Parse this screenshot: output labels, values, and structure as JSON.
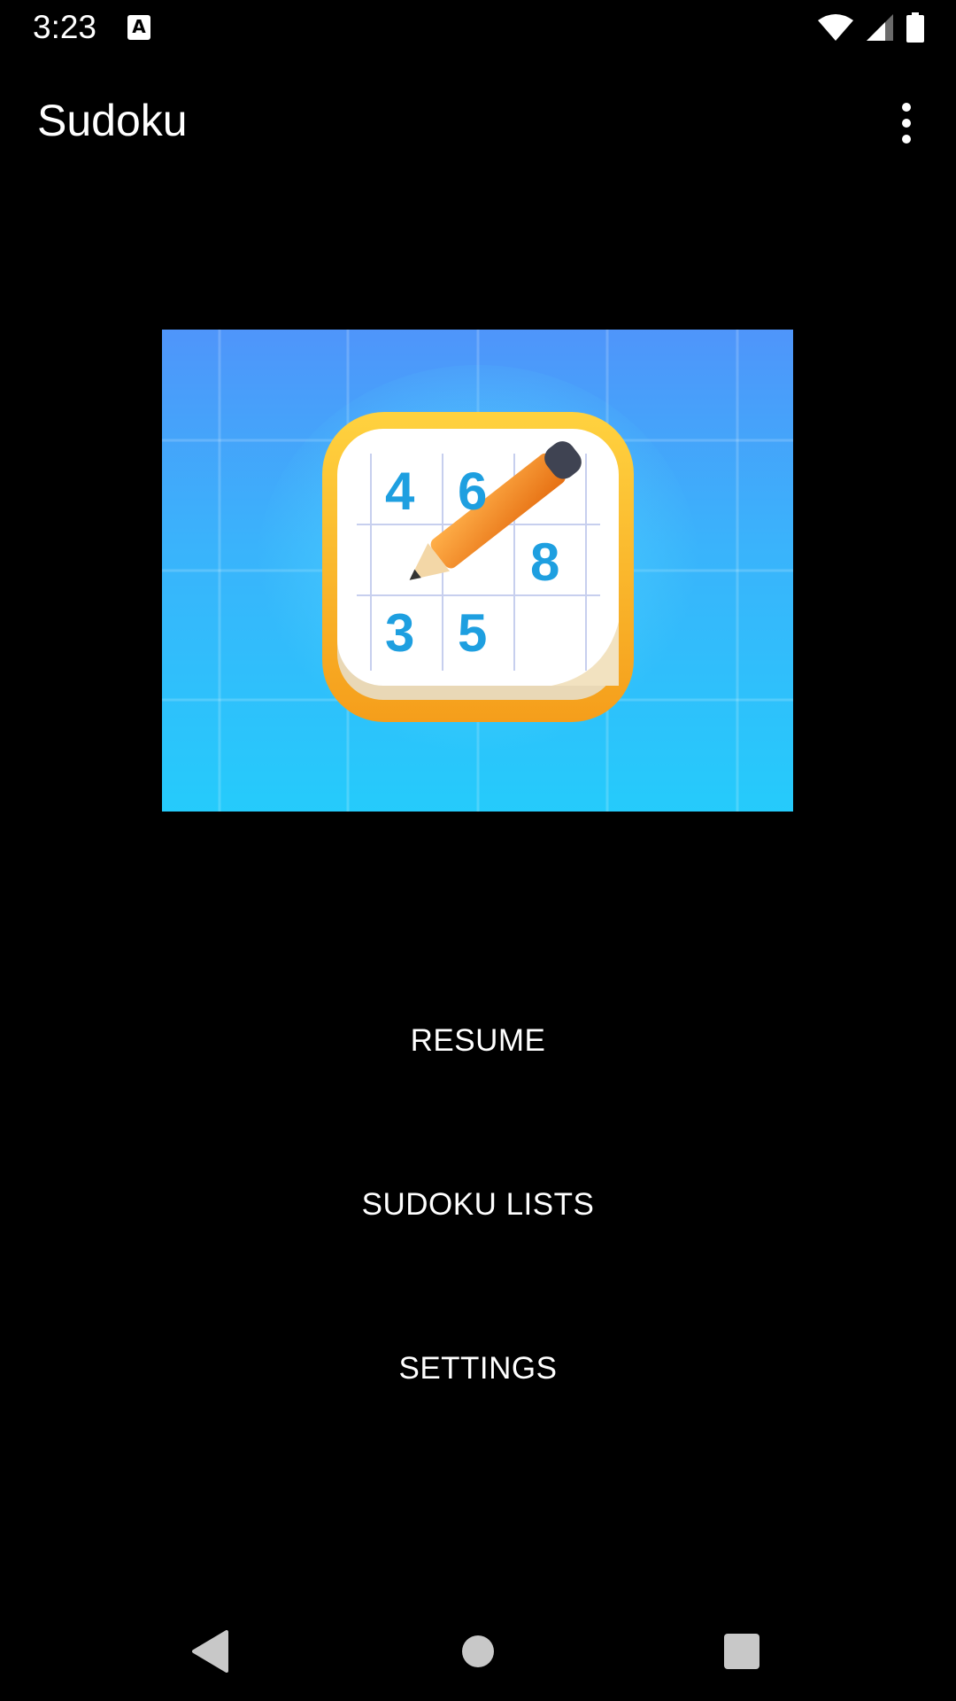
{
  "status_bar": {
    "time": "3:23",
    "notification_icon": "A",
    "icons": [
      "wifi-icon",
      "signal-icon",
      "battery-icon"
    ]
  },
  "app_bar": {
    "title": "Sudoku",
    "overflow_icon": "more-vert-icon"
  },
  "hero_image": {
    "digits": [
      "4",
      "6",
      "8",
      "3",
      "5"
    ],
    "colors": {
      "background_top": "#4f95fa",
      "background_bottom": "#25cbfb",
      "frame": "#f7b324",
      "digit": "#1e9fe0",
      "pencil": "#f28a22"
    }
  },
  "menu": {
    "resume_label": "RESUME",
    "sudoku_lists_label": "SUDOKU LISTS",
    "settings_label": "SETTINGS"
  },
  "nav_bar": {
    "icons": [
      "back-icon",
      "home-icon",
      "recents-icon"
    ]
  }
}
